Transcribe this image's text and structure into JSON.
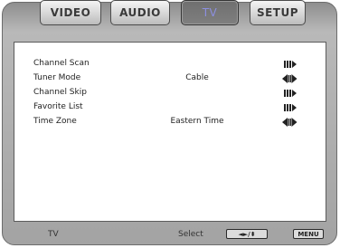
{
  "tabs": [
    {
      "label": "VIDEO",
      "active": false
    },
    {
      "label": "AUDIO",
      "active": false
    },
    {
      "label": "TV",
      "active": true
    },
    {
      "label": "SETUP",
      "active": false
    }
  ],
  "menu": {
    "items": [
      {
        "label": "Channel Scan",
        "value": "",
        "icon": "enter-arrow-icon"
      },
      {
        "label": "Tuner Mode",
        "value": "Cable",
        "icon": "left-right-arrow-icon"
      },
      {
        "label": "Channel Skip",
        "value": "",
        "icon": "enter-arrow-icon"
      },
      {
        "label": "Favorite List",
        "value": "",
        "icon": "enter-arrow-icon"
      },
      {
        "label": "Time Zone",
        "value": "Eastern Time",
        "icon": "left-right-arrow-icon"
      }
    ]
  },
  "footer": {
    "section": "TV",
    "hint": "Select",
    "nav_key": "◄►/⬍",
    "menu_key": "MENU"
  },
  "colors": {
    "active_tab_text": "#8c8fe0",
    "frame": "#a3a3a3"
  }
}
